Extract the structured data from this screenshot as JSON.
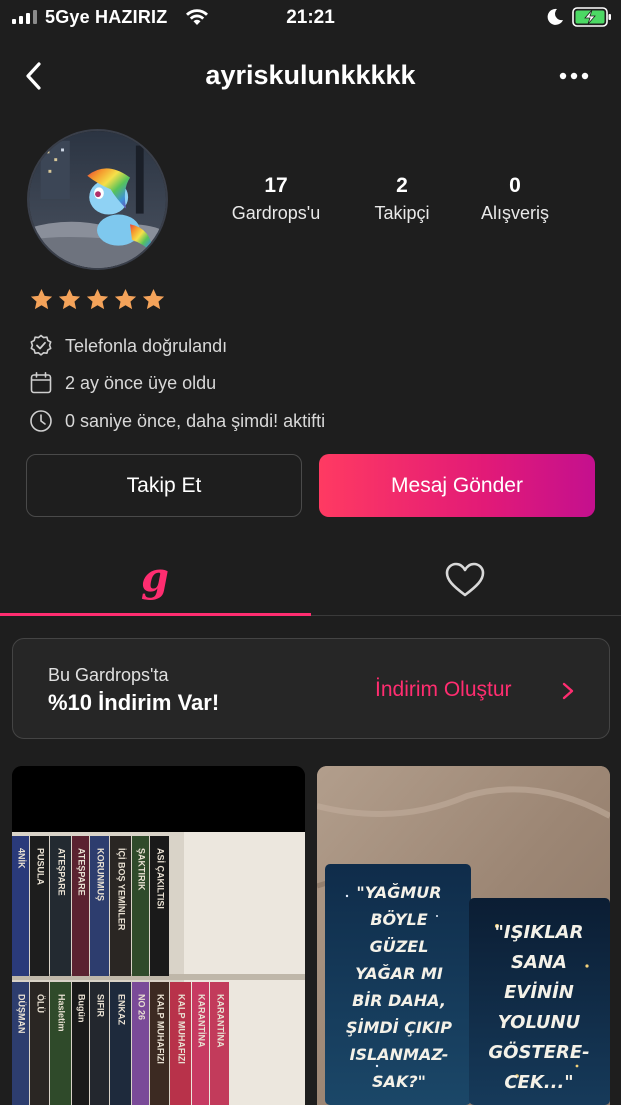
{
  "status_bar": {
    "carrier": "5Gye HAZIRIZ",
    "time": "21:21",
    "icons": [
      "signal-icon",
      "wifi-icon",
      "moon-icon",
      "battery-charging-icon"
    ]
  },
  "nav": {
    "title": "ayriskulunkkkkk",
    "back_icon": "chevron-left-icon",
    "more_icon": "more-horizontal-icon"
  },
  "profile": {
    "stats": [
      {
        "value": "17",
        "label": "Gardrops'u"
      },
      {
        "value": "2",
        "label": "Takipçi"
      },
      {
        "value": "0",
        "label": "Alışveriş"
      }
    ],
    "rating": 5,
    "rating_max": 5,
    "info": [
      {
        "icon": "verified-badge-icon",
        "text": "Telefonla doğrulandı"
      },
      {
        "icon": "calendar-icon",
        "text": "2 ay önce üye oldu"
      },
      {
        "icon": "clock-icon",
        "text": "0 saniye önce, daha şimdi! aktifti"
      }
    ]
  },
  "actions": {
    "follow": "Takip Et",
    "message": "Mesaj Gönder"
  },
  "tabs": [
    {
      "name": "wardrobe",
      "glyph": "g",
      "active": true
    },
    {
      "name": "likes",
      "icon": "heart-icon",
      "active": false
    }
  ],
  "discount": {
    "line1": "Bu Gardrops'ta",
    "line2": "%10 İndirim Var!",
    "action": "İndirim Oluştur"
  },
  "products": [
    {
      "id": "books-shelf",
      "spines": [
        "4NİK",
        "PUSULA",
        "ATEŞPARE",
        "ATEŞPARE",
        "KORUNMUŞ",
        "İÇİ BOŞ YEMİNLER",
        "ŞAKTIRIK",
        "ASİ ÇAKILTISI",
        "DÜŞMAN",
        "ÖLÜ",
        "Hasletim",
        "Bugün",
        "SIFIR",
        "ENKAZ",
        "NO 26",
        "KALP MUHAFIZI",
        "KALP MUHAFIZI",
        "KARANTİNA",
        "KARANTİNA"
      ]
    },
    {
      "id": "quote-notebooks",
      "left_quote": [
        "\"YAĞMUR",
        "BÖYLE",
        "GÜZEL",
        "YAĞAR MI",
        "BİR DAHA,",
        "ŞİMDİ ÇIKIP",
        "ISLANMAZ-",
        "SAK?\""
      ],
      "right_quote": [
        "\"IŞIKLAR",
        "SANA",
        "EVİNİN",
        "YOLUNU",
        "GÖSTERE-",
        "CEK...\""
      ]
    }
  ],
  "colors": {
    "background": "#1e1e1e",
    "accent": "#ff2d70",
    "star": "#f4a35a",
    "message_gradient": [
      "#ff3a62",
      "#c4108e"
    ]
  }
}
